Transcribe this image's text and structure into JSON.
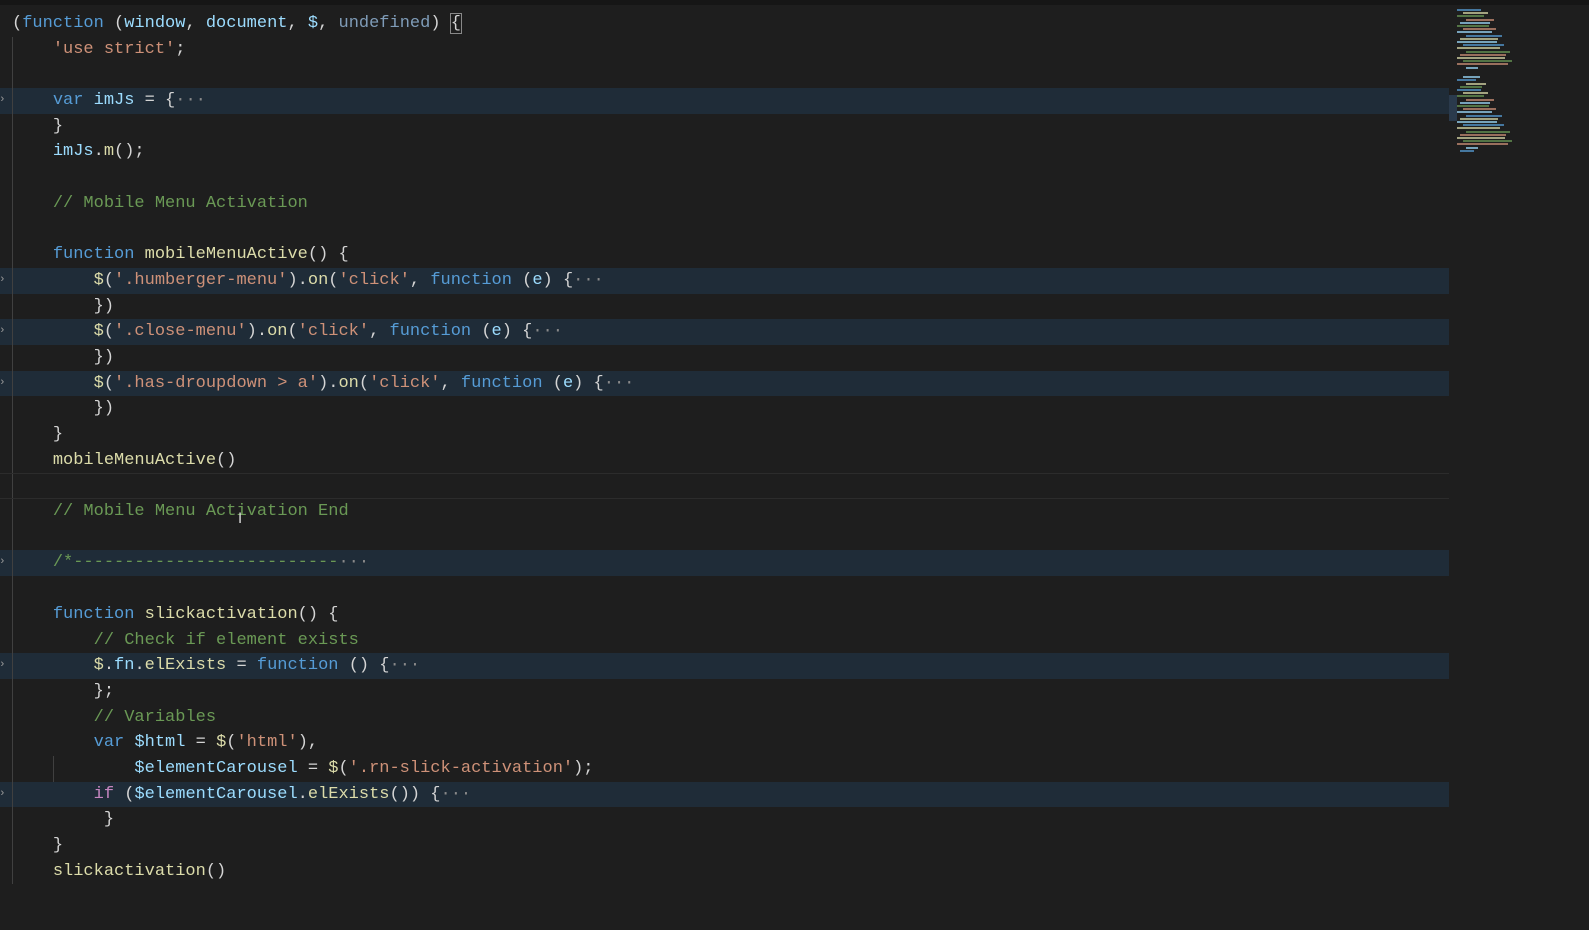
{
  "lines": [
    {
      "indent": 0,
      "tokens": [
        [
          "p",
          "("
        ],
        [
          "kw",
          "function"
        ],
        [
          "p",
          " ("
        ],
        [
          "var",
          "window"
        ],
        [
          "p",
          ", "
        ],
        [
          "var",
          "document"
        ],
        [
          "p",
          ", "
        ],
        [
          "var",
          "$"
        ],
        [
          "p",
          ", "
        ],
        [
          "un",
          "undefined"
        ],
        [
          "p",
          ") "
        ],
        [
          "p",
          "{"
        ]
      ],
      "bracket": true
    },
    {
      "indent": 1,
      "tokens": [
        [
          "str",
          "'use strict'"
        ],
        [
          "p",
          ";"
        ]
      ]
    },
    {
      "indent": 1,
      "tokens": []
    },
    {
      "indent": 1,
      "fold": true,
      "tokens": [
        [
          "kw",
          "var"
        ],
        [
          "p",
          " "
        ],
        [
          "var",
          "imJs"
        ],
        [
          "p",
          " = {"
        ]
      ]
    },
    {
      "indent": 1,
      "tokens": [
        [
          "p",
          "}"
        ]
      ]
    },
    {
      "indent": 1,
      "tokens": [
        [
          "var",
          "imJs"
        ],
        [
          "p",
          "."
        ],
        [
          "fn",
          "m"
        ],
        [
          "p",
          "();"
        ]
      ]
    },
    {
      "indent": 1,
      "tokens": []
    },
    {
      "indent": 1,
      "tokens": [
        [
          "cm",
          "// Mobile Menu Activation"
        ]
      ]
    },
    {
      "indent": 1,
      "tokens": []
    },
    {
      "indent": 1,
      "tokens": [
        [
          "kw",
          "function"
        ],
        [
          "p",
          " "
        ],
        [
          "fn",
          "mobileMenuActive"
        ],
        [
          "p",
          "() {"
        ]
      ]
    },
    {
      "indent": 2,
      "fold": true,
      "tokens": [
        [
          "fn",
          "$"
        ],
        [
          "p",
          "("
        ],
        [
          "str",
          "'.humberger-menu'"
        ],
        [
          "p",
          ")."
        ],
        [
          "fn",
          "on"
        ],
        [
          "p",
          "("
        ],
        [
          "str",
          "'click'"
        ],
        [
          "p",
          ", "
        ],
        [
          "kw",
          "function"
        ],
        [
          "p",
          " ("
        ],
        [
          "var",
          "e"
        ],
        [
          "p",
          ") {"
        ]
      ]
    },
    {
      "indent": 2,
      "tokens": [
        [
          "p",
          "})"
        ]
      ]
    },
    {
      "indent": 2,
      "fold": true,
      "tokens": [
        [
          "fn",
          "$"
        ],
        [
          "p",
          "("
        ],
        [
          "str",
          "'.close-menu'"
        ],
        [
          "p",
          ")."
        ],
        [
          "fn",
          "on"
        ],
        [
          "p",
          "("
        ],
        [
          "str",
          "'click'"
        ],
        [
          "p",
          ", "
        ],
        [
          "kw",
          "function"
        ],
        [
          "p",
          " ("
        ],
        [
          "var",
          "e"
        ],
        [
          "p",
          ") {"
        ]
      ]
    },
    {
      "indent": 2,
      "tokens": [
        [
          "p",
          "})"
        ]
      ]
    },
    {
      "indent": 2,
      "fold": true,
      "tokens": [
        [
          "fn",
          "$"
        ],
        [
          "p",
          "("
        ],
        [
          "str",
          "'.has-droupdown > a'"
        ],
        [
          "p",
          ")."
        ],
        [
          "fn",
          "on"
        ],
        [
          "p",
          "("
        ],
        [
          "str",
          "'click'"
        ],
        [
          "p",
          ", "
        ],
        [
          "kw",
          "function"
        ],
        [
          "p",
          " ("
        ],
        [
          "var",
          "e"
        ],
        [
          "p",
          ") {"
        ]
      ]
    },
    {
      "indent": 2,
      "tokens": [
        [
          "p",
          "})"
        ]
      ]
    },
    {
      "indent": 1,
      "tokens": [
        [
          "p",
          "}"
        ]
      ]
    },
    {
      "indent": 1,
      "tokens": [
        [
          "fn",
          "mobileMenuActive"
        ],
        [
          "p",
          "()"
        ]
      ]
    },
    {
      "indent": 0,
      "current": true,
      "tokens": []
    },
    {
      "indent": 1,
      "tokens": [
        [
          "cm",
          "// Mobile Menu Activation End"
        ]
      ]
    },
    {
      "indent": 1,
      "tokens": []
    },
    {
      "indent": 1,
      "fold": true,
      "tokens": [
        [
          "cm",
          "/*--------------------------"
        ]
      ]
    },
    {
      "indent": 1,
      "tokens": []
    },
    {
      "indent": 1,
      "tokens": [
        [
          "kw",
          "function"
        ],
        [
          "p",
          " "
        ],
        [
          "fn",
          "slickactivation"
        ],
        [
          "p",
          "() {"
        ]
      ]
    },
    {
      "indent": 2,
      "tokens": [
        [
          "cm",
          "// Check if element exists"
        ]
      ]
    },
    {
      "indent": 2,
      "fold": true,
      "tokens": [
        [
          "fn",
          "$"
        ],
        [
          "p",
          "."
        ],
        [
          "var",
          "fn"
        ],
        [
          "p",
          "."
        ],
        [
          "fn",
          "elExists"
        ],
        [
          "p",
          " = "
        ],
        [
          "kw",
          "function"
        ],
        [
          "p",
          " () {"
        ]
      ]
    },
    {
      "indent": 2,
      "tokens": [
        [
          "p",
          "};"
        ]
      ]
    },
    {
      "indent": 2,
      "tokens": [
        [
          "cm",
          "// Variables"
        ]
      ]
    },
    {
      "indent": 2,
      "tokens": [
        [
          "kw",
          "var"
        ],
        [
          "p",
          " "
        ],
        [
          "var",
          "$html"
        ],
        [
          "p",
          " = "
        ],
        [
          "fn",
          "$"
        ],
        [
          "p",
          "("
        ],
        [
          "str",
          "'html'"
        ],
        [
          "p",
          "),"
        ]
      ]
    },
    {
      "indent": 3,
      "tokens": [
        [
          "var",
          "$elementCarousel"
        ],
        [
          "p",
          " = "
        ],
        [
          "fn",
          "$"
        ],
        [
          "p",
          "("
        ],
        [
          "str",
          "'.rn-slick-activation'"
        ],
        [
          "p",
          ");"
        ]
      ]
    },
    {
      "indent": 2,
      "fold": true,
      "tokens": [
        [
          "ctl",
          "if"
        ],
        [
          "p",
          " ("
        ],
        [
          "var",
          "$elementCarousel"
        ],
        [
          "p",
          "."
        ],
        [
          "fn",
          "elExists"
        ],
        [
          "p",
          "()) {"
        ]
      ]
    },
    {
      "indent": 2,
      "tokens": [
        [
          "p",
          " }"
        ]
      ]
    },
    {
      "indent": 1,
      "tokens": [
        [
          "p",
          "}"
        ]
      ]
    },
    {
      "indent": 1,
      "tokens": [
        [
          "fn",
          "slickactivation"
        ],
        [
          "p",
          "()"
        ]
      ]
    }
  ],
  "fold_ellipsis": "···",
  "fold_chevron": "›",
  "cursor_icon": "I"
}
